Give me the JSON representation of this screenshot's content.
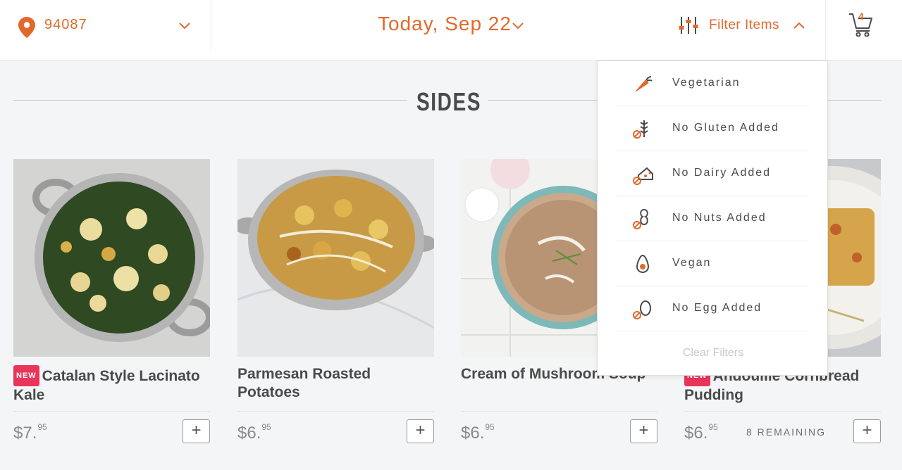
{
  "header": {
    "zip": "94087",
    "date": "Today, Sep 22",
    "filter_label": "Filter Items",
    "cart_count": "4"
  },
  "section": {
    "title": "SIDES"
  },
  "products": [
    {
      "badge": "NEW",
      "name": "Catalan Style Lacinato Kale",
      "price_main": "$7.",
      "price_cents": "95",
      "remaining": "",
      "add": "+"
    },
    {
      "badge": "",
      "name": "Parmesan Roasted Potatoes",
      "price_main": "$6.",
      "price_cents": "95",
      "remaining": "",
      "add": "+"
    },
    {
      "badge": "",
      "name": "Cream of Mushroom Soup",
      "price_main": "$6.",
      "price_cents": "95",
      "remaining": "",
      "add": "+"
    },
    {
      "badge": "NEW",
      "name": "Andouille Cornbread Pudding",
      "price_main": "$6.",
      "price_cents": "95",
      "remaining": "8 REMAINING",
      "add": "+"
    }
  ],
  "filters": {
    "items": [
      {
        "label": "Vegetarian",
        "icon": "carrot-icon"
      },
      {
        "label": "No Gluten Added",
        "icon": "wheat-icon"
      },
      {
        "label": "No Dairy Added",
        "icon": "cheese-icon"
      },
      {
        "label": "No Nuts Added",
        "icon": "peanut-icon"
      },
      {
        "label": "Vegan",
        "icon": "avocado-icon"
      },
      {
        "label": "No Egg Added",
        "icon": "egg-icon"
      }
    ],
    "clear_label": "Clear Filters"
  },
  "colors": {
    "accent": "#e2692c",
    "badge": "#e8355a",
    "text": "#4a4a4a",
    "background": "#f4f5f6"
  }
}
